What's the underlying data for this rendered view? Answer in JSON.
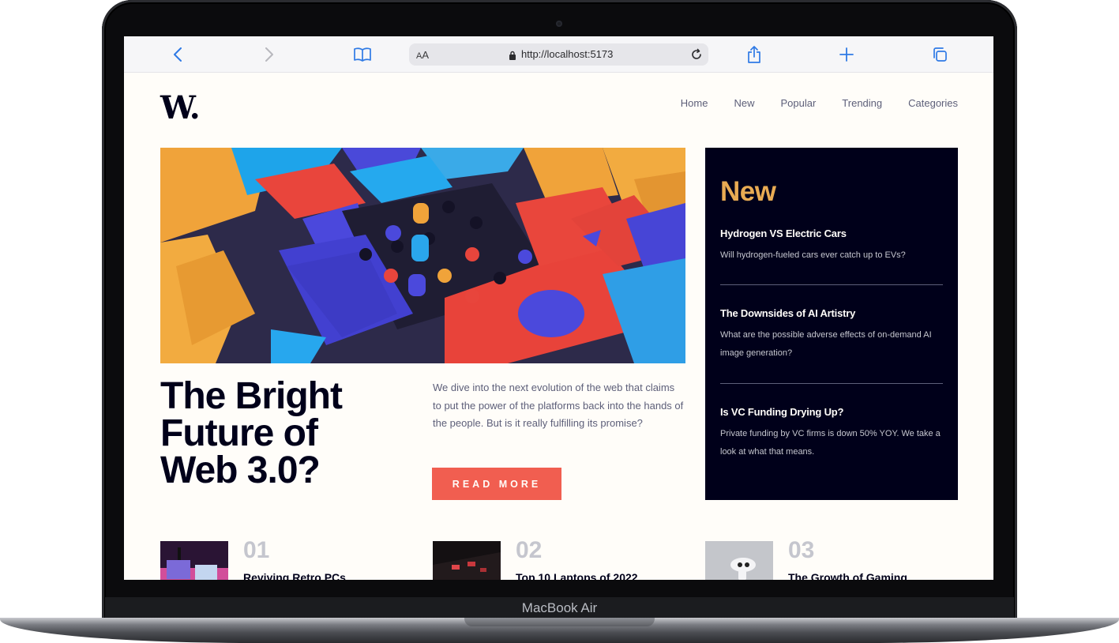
{
  "device": {
    "label": "MacBook Air"
  },
  "browser": {
    "text_size_label": "AA",
    "url": "http://localhost:5173"
  },
  "site": {
    "logo": "W.",
    "nav": [
      "Home",
      "New",
      "Popular",
      "Trending",
      "Categories"
    ]
  },
  "hero": {
    "title_lines": [
      "The Bright",
      "Future of",
      "Web 3.0?"
    ],
    "description": "We dive into the next evolution of the web that claims to put the power of the platforms back into the hands of the people. But is it really fulfilling its promise?",
    "cta": "READ MORE"
  },
  "sidebar": {
    "heading": "New",
    "items": [
      {
        "title": "Hydrogen VS Electric Cars",
        "text": "Will hydrogen-fueled cars ever catch up to EVs?"
      },
      {
        "title": "The Downsides of AI Artistry",
        "text": "What are the possible adverse effects of on-demand AI image generation?"
      },
      {
        "title": "Is VC Funding Drying Up?",
        "text": "Private funding by VC firms is down 50% YOY. We take a look at what that means."
      }
    ]
  },
  "articles": [
    {
      "number": "01",
      "title": "Reviving Retro PCs"
    },
    {
      "number": "02",
      "title": "Top 10 Laptops of 2022"
    },
    {
      "number": "03",
      "title": "The Growth of Gaming"
    }
  ],
  "colors": {
    "accent": "#f15e50",
    "sidebar_bg": "#00001a",
    "sidebar_heading": "#e9ab53",
    "page_bg": "#fffdf9",
    "text_dark": "#00001a",
    "text_muted": "#5d5f79",
    "number_grey": "#c5c6ce",
    "browser_icon_blue": "#2f7ae5"
  }
}
